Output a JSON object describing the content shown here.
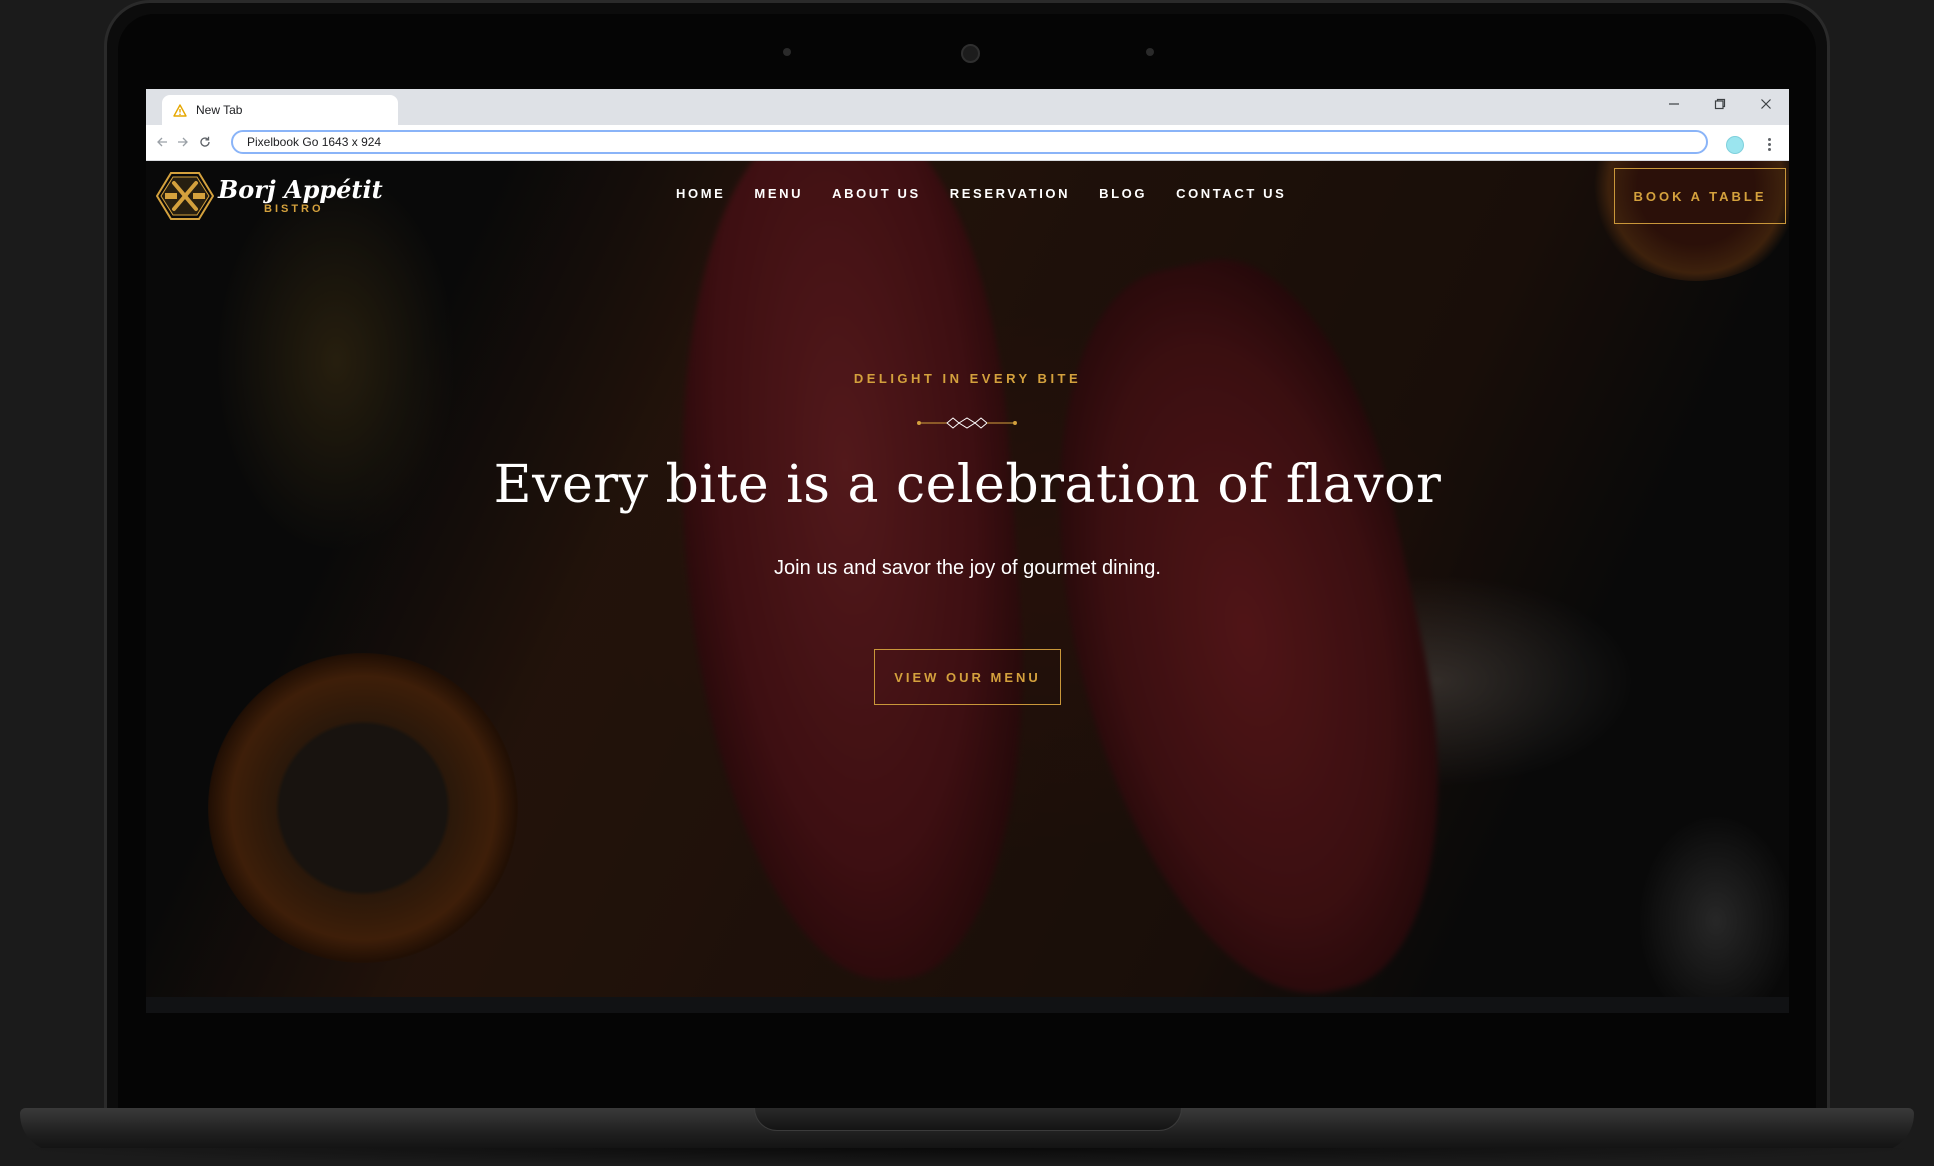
{
  "browser": {
    "tab_title": "New Tab",
    "address": "Pixelbook Go  1643 x 924"
  },
  "site": {
    "logo_name": "Borj Appétit",
    "logo_sub": "BISTRO",
    "nav": [
      "HOME",
      "MENU",
      "ABOUT US",
      "RESERVATION",
      "BLOG",
      "CONTACT US"
    ],
    "cta": "BOOK A TABLE"
  },
  "hero": {
    "eyebrow": "DELIGHT IN EVERY BITE",
    "title": "Every bite is a celebration of flavor",
    "subtitle": "Join us and savor the joy of gourmet dining.",
    "button": "VIEW OUR MENU"
  },
  "colors": {
    "accent": "#d4a13d",
    "browser_focus": "#8ab4f8"
  },
  "icons": {
    "tab": "warning-icon",
    "back": "arrow-left-icon",
    "forward": "arrow-right-icon",
    "reload": "reload-icon",
    "minimize": "minimize-icon",
    "restore": "restore-icon",
    "close": "close-icon",
    "menu": "kebab-menu-icon",
    "logo": "crossed-fork-knife-logo-icon"
  }
}
